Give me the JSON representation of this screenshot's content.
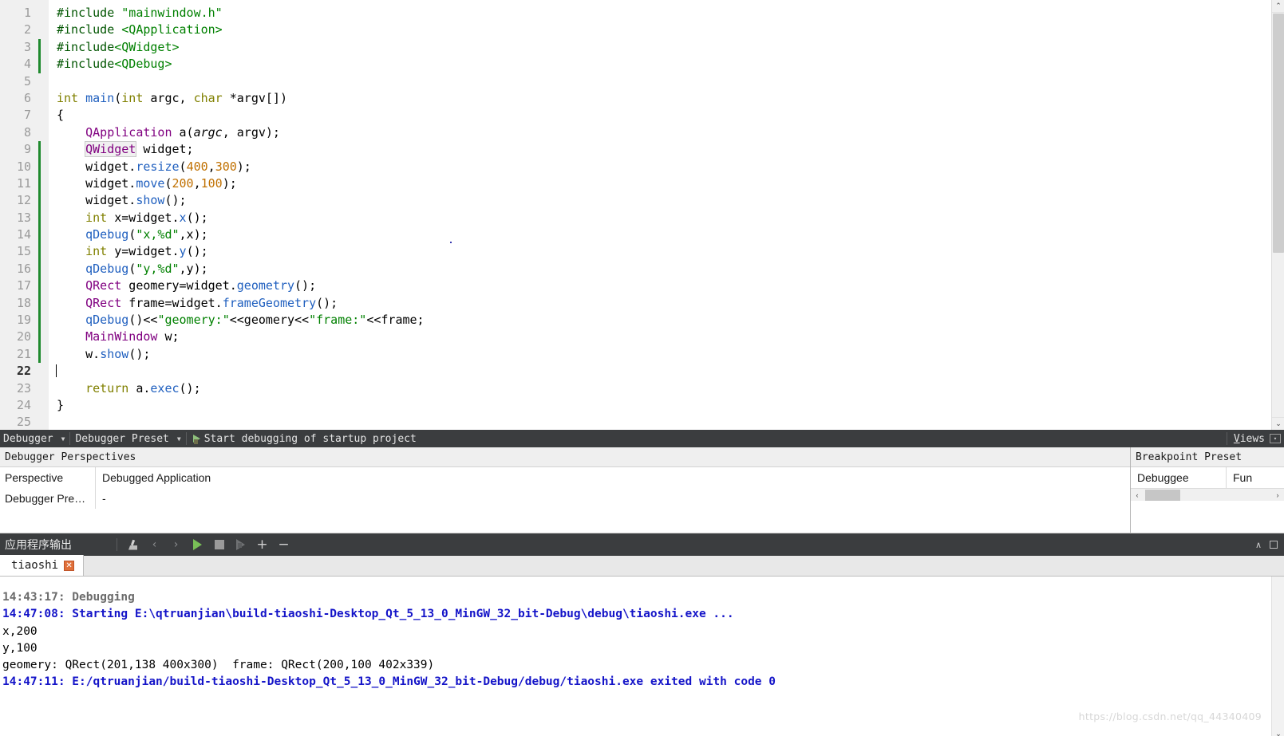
{
  "editor": {
    "lines": [
      {
        "n": 1,
        "changed": false,
        "fold": "",
        "tokens": [
          {
            "t": "#include ",
            "c": "tok-pre"
          },
          {
            "t": "\"mainwindow.h\"",
            "c": "tok-str"
          }
        ]
      },
      {
        "n": 2,
        "changed": false,
        "fold": "",
        "tokens": [
          {
            "t": "#include ",
            "c": "tok-pre"
          },
          {
            "t": "<QApplication>",
            "c": "tok-str"
          }
        ]
      },
      {
        "n": 3,
        "changed": true,
        "fold": "",
        "tokens": [
          {
            "t": "#include",
            "c": "tok-pre"
          },
          {
            "t": "<QWidget>",
            "c": "tok-str"
          }
        ]
      },
      {
        "n": 4,
        "changed": true,
        "fold": "",
        "tokens": [
          {
            "t": "#include",
            "c": "tok-pre"
          },
          {
            "t": "<QDebug>",
            "c": "tok-str"
          }
        ]
      },
      {
        "n": 5,
        "changed": false,
        "fold": "",
        "tokens": []
      },
      {
        "n": 6,
        "changed": false,
        "fold": "v",
        "tokens": [
          {
            "t": "int",
            "c": "tok-kw"
          },
          {
            "t": " ",
            "c": "tok-op"
          },
          {
            "t": "main",
            "c": "tok-fn"
          },
          {
            "t": "(",
            "c": "tok-op"
          },
          {
            "t": "int",
            "c": "tok-kw"
          },
          {
            "t": " argc, ",
            "c": "tok-op"
          },
          {
            "t": "char",
            "c": "tok-kw"
          },
          {
            "t": " *argv[])",
            "c": "tok-op"
          }
        ]
      },
      {
        "n": 7,
        "changed": false,
        "fold": "",
        "tokens": [
          {
            "t": "{",
            "c": "tok-op"
          }
        ]
      },
      {
        "n": 8,
        "changed": false,
        "fold": "",
        "tokens": [
          {
            "t": "    ",
            "c": "tok-op"
          },
          {
            "t": "QApplication",
            "c": "tok-type"
          },
          {
            "t": " a(",
            "c": "tok-op"
          },
          {
            "t": "argc",
            "c": "tok-param"
          },
          {
            "t": ", argv);",
            "c": "tok-op"
          }
        ]
      },
      {
        "n": 9,
        "changed": true,
        "fold": "",
        "tokens": [
          {
            "t": "    ",
            "c": "tok-op"
          },
          {
            "t": "QWidget",
            "c": "tok-type tok-hl"
          },
          {
            "t": " widget;",
            "c": "tok-op"
          }
        ]
      },
      {
        "n": 10,
        "changed": true,
        "fold": "",
        "tokens": [
          {
            "t": "    widget.",
            "c": "tok-op"
          },
          {
            "t": "resize",
            "c": "tok-fn"
          },
          {
            "t": "(",
            "c": "tok-op"
          },
          {
            "t": "400",
            "c": "tok-num"
          },
          {
            "t": ",",
            "c": "tok-op"
          },
          {
            "t": "300",
            "c": "tok-num"
          },
          {
            "t": ");",
            "c": "tok-op"
          }
        ]
      },
      {
        "n": 11,
        "changed": true,
        "fold": "",
        "tokens": [
          {
            "t": "    widget.",
            "c": "tok-op"
          },
          {
            "t": "move",
            "c": "tok-fn"
          },
          {
            "t": "(",
            "c": "tok-op"
          },
          {
            "t": "200",
            "c": "tok-num"
          },
          {
            "t": ",",
            "c": "tok-op"
          },
          {
            "t": "100",
            "c": "tok-num"
          },
          {
            "t": ");",
            "c": "tok-op"
          }
        ]
      },
      {
        "n": 12,
        "changed": true,
        "fold": "",
        "tokens": [
          {
            "t": "    widget.",
            "c": "tok-op"
          },
          {
            "t": "show",
            "c": "tok-fn"
          },
          {
            "t": "();",
            "c": "tok-op"
          }
        ]
      },
      {
        "n": 13,
        "changed": true,
        "fold": "",
        "tokens": [
          {
            "t": "    ",
            "c": "tok-op"
          },
          {
            "t": "int",
            "c": "tok-kw"
          },
          {
            "t": " x=widget.",
            "c": "tok-op"
          },
          {
            "t": "x",
            "c": "tok-fn"
          },
          {
            "t": "();",
            "c": "tok-op"
          }
        ]
      },
      {
        "n": 14,
        "changed": true,
        "fold": "",
        "tokens": [
          {
            "t": "    ",
            "c": "tok-op"
          },
          {
            "t": "qDebug",
            "c": "tok-fn"
          },
          {
            "t": "(",
            "c": "tok-op"
          },
          {
            "t": "\"x,%d\"",
            "c": "tok-str"
          },
          {
            "t": ",x);",
            "c": "tok-op"
          }
        ]
      },
      {
        "n": 15,
        "changed": true,
        "fold": "",
        "tokens": [
          {
            "t": "    ",
            "c": "tok-op"
          },
          {
            "t": "int",
            "c": "tok-kw"
          },
          {
            "t": " y=widget.",
            "c": "tok-op"
          },
          {
            "t": "y",
            "c": "tok-fn"
          },
          {
            "t": "();",
            "c": "tok-op"
          }
        ]
      },
      {
        "n": 16,
        "changed": true,
        "fold": "",
        "tokens": [
          {
            "t": "    ",
            "c": "tok-op"
          },
          {
            "t": "qDebug",
            "c": "tok-fn"
          },
          {
            "t": "(",
            "c": "tok-op"
          },
          {
            "t": "\"y,%d\"",
            "c": "tok-str"
          },
          {
            "t": ",y);",
            "c": "tok-op"
          }
        ]
      },
      {
        "n": 17,
        "changed": true,
        "fold": "",
        "tokens": [
          {
            "t": "    ",
            "c": "tok-op"
          },
          {
            "t": "QRect",
            "c": "tok-type"
          },
          {
            "t": " geomery=widget.",
            "c": "tok-op"
          },
          {
            "t": "geometry",
            "c": "tok-fn"
          },
          {
            "t": "();",
            "c": "tok-op"
          }
        ]
      },
      {
        "n": 18,
        "changed": true,
        "fold": "",
        "tokens": [
          {
            "t": "    ",
            "c": "tok-op"
          },
          {
            "t": "QRect",
            "c": "tok-type"
          },
          {
            "t": " frame=widget.",
            "c": "tok-op"
          },
          {
            "t": "frameGeometry",
            "c": "tok-fn"
          },
          {
            "t": "();",
            "c": "tok-op"
          }
        ]
      },
      {
        "n": 19,
        "changed": true,
        "fold": "",
        "tokens": [
          {
            "t": "    ",
            "c": "tok-op"
          },
          {
            "t": "qDebug",
            "c": "tok-fn"
          },
          {
            "t": "()<<",
            "c": "tok-op"
          },
          {
            "t": "\"geomery:\"",
            "c": "tok-str"
          },
          {
            "t": "<<geomery<<",
            "c": "tok-op"
          },
          {
            "t": "\"frame:\"",
            "c": "tok-str"
          },
          {
            "t": "<<frame;",
            "c": "tok-op"
          }
        ]
      },
      {
        "n": 20,
        "changed": true,
        "fold": "",
        "tokens": [
          {
            "t": "    ",
            "c": "tok-op"
          },
          {
            "t": "MainWindow",
            "c": "tok-type"
          },
          {
            "t": " w;",
            "c": "tok-op"
          }
        ]
      },
      {
        "n": 21,
        "changed": true,
        "fold": "",
        "tokens": [
          {
            "t": "    w.",
            "c": "tok-op"
          },
          {
            "t": "show",
            "c": "tok-fn"
          },
          {
            "t": "();",
            "c": "tok-op"
          }
        ]
      },
      {
        "n": 22,
        "changed": false,
        "fold": "",
        "current": true,
        "tokens": []
      },
      {
        "n": 23,
        "changed": false,
        "fold": "",
        "tokens": [
          {
            "t": "    ",
            "c": "tok-op"
          },
          {
            "t": "return",
            "c": "tok-kw"
          },
          {
            "t": " a.",
            "c": "tok-op"
          },
          {
            "t": "exec",
            "c": "tok-fn"
          },
          {
            "t": "();",
            "c": "tok-op"
          }
        ]
      },
      {
        "n": 24,
        "changed": false,
        "fold": "",
        "tokens": [
          {
            "t": "}",
            "c": "tok-op"
          }
        ]
      },
      {
        "n": 25,
        "changed": false,
        "fold": "",
        "tokens": []
      }
    ]
  },
  "debugger_toolbar": {
    "mode_label": "Debugger",
    "preset_label": "Debugger Preset",
    "start_action": "Start debugging of startup project",
    "views_label_prefix": "V",
    "views_label_rest": "iews",
    "dropdown_arrow": "▼",
    "views_menu_icon": "▾"
  },
  "perspectives": {
    "header": "Debugger Perspectives",
    "rows": [
      {
        "key": "Perspective",
        "value": "Debugged Application"
      },
      {
        "key": "Debugger Pre…",
        "value": "-"
      }
    ]
  },
  "breakpoints": {
    "header": "Breakpoint Preset",
    "columns": [
      "Debuggee",
      "Fun"
    ],
    "scroll_left_icon": "‹",
    "scroll_right_icon": "›"
  },
  "output_toolbar": {
    "title": "应用程序输出",
    "icons": [
      {
        "name": "clean-output-icon",
        "glyph": ""
      },
      {
        "name": "prev-item-icon",
        "glyph": "‹"
      },
      {
        "name": "next-item-icon",
        "glyph": "›"
      },
      {
        "name": "run-icon",
        "glyph": ""
      },
      {
        "name": "stop-icon",
        "glyph": ""
      },
      {
        "name": "debug-run-icon",
        "glyph": ""
      },
      {
        "name": "zoom-in-icon",
        "glyph": "+"
      },
      {
        "name": "zoom-out-icon",
        "glyph": "−"
      }
    ],
    "minimize_icon": "∧",
    "maximize_icon": "□"
  },
  "tabs": [
    {
      "label": "tiaoshi",
      "close": "✕",
      "active": true
    }
  ],
  "console": {
    "lines": [
      {
        "text": "14:43:17: Debugging",
        "style": "c-gray"
      },
      {
        "text": "14:47:08: Starting E:\\qtruanjian\\build-tiaoshi-Desktop_Qt_5_13_0_MinGW_32_bit-Debug\\debug\\tiaoshi.exe ...",
        "style": "c-blue"
      },
      {
        "text": "x,200",
        "style": "c-black"
      },
      {
        "text": "y,100",
        "style": "c-black"
      },
      {
        "text": "geomery: QRect(201,138 400x300)  frame: QRect(200,100 402x339)",
        "style": "c-black"
      },
      {
        "text": "14:47:11: E:/qtruanjian/build-tiaoshi-Desktop_Qt_5_13_0_MinGW_32_bit-Debug/debug/tiaoshi.exe exited with code 0",
        "style": "c-blue"
      }
    ],
    "watermark": "https://blog.csdn.net/qq_44340409",
    "scroll_down_icon": "⌄"
  },
  "scrollbars": {
    "up_icon": "⌃",
    "down_icon": "⌄"
  },
  "colors": {
    "toolbar_bg": "#3b3d3f",
    "gutter_bg": "#f0f0f0",
    "changed_marker": "#1f8a2e",
    "console_blue": "#1414c8",
    "tab_close": "#e0703a",
    "run_green": "#79c057"
  }
}
